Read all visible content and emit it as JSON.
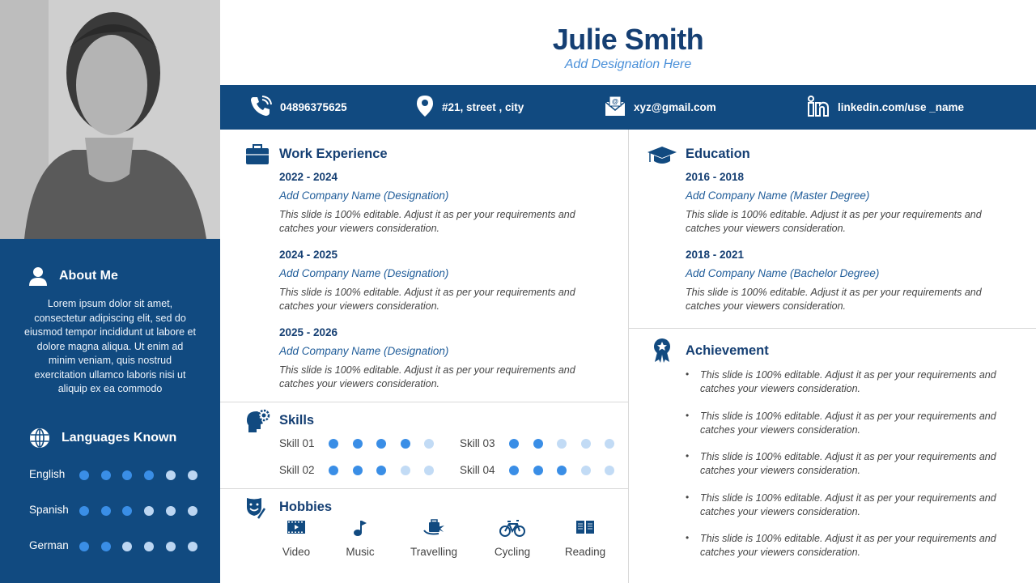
{
  "colors": {
    "primary": "#114a80",
    "heading": "#153f73",
    "accent": "#4a90d9",
    "dot_filled": "#3a8ee6",
    "dot_empty": "#c2dbf5",
    "dot_empty_dark": "#bcd6f2"
  },
  "header": {
    "name": "Julie Smith",
    "designation": "Add Designation Here"
  },
  "contacts": [
    {
      "icon": "phone-icon",
      "text": "04896375625"
    },
    {
      "icon": "location-pin-icon",
      "text": "#21, street , city"
    },
    {
      "icon": "email-icon",
      "text": "xyz@gmail.com"
    },
    {
      "icon": "linkedin-icon",
      "text": "linkedin.com/use _name"
    }
  ],
  "photo": {
    "icon": "profile-photo"
  },
  "about": {
    "title": "About Me",
    "icon": "user-icon",
    "text": "Lorem ipsum dolor sit amet, consectetur adipiscing elit, sed do eiusmod tempor incididunt ut labore et dolore magna aliqua. Ut enim ad minim veniam, quis nostrud exercitation ullamco laboris nisi ut aliquip ex ea commodo"
  },
  "languages": {
    "title": "Languages Known",
    "icon": "globe-icon",
    "max": 6,
    "items": [
      {
        "name": "English",
        "level": 4
      },
      {
        "name": "Spanish",
        "level": 3
      },
      {
        "name": "German",
        "level": 2
      }
    ]
  },
  "work": {
    "title": "Work Experience",
    "icon": "briefcase-icon",
    "items": [
      {
        "date": "2022 - 2024",
        "company": "Add Company Name (Designation)",
        "desc": "This slide is 100%  editable. Adjust it as per your requirements and catches your viewers consideration."
      },
      {
        "date": "2024 - 2025",
        "company": "Add Company Name (Designation)",
        "desc": "This slide is 100%  editable. Adjust it as per your requirements and catches your viewers consideration."
      },
      {
        "date": "2025 - 2026",
        "company": "Add Company Name (Designation)",
        "desc": "This slide is 100%  editable. Adjust it as per your requirements and catches your viewers consideration."
      }
    ]
  },
  "education": {
    "title": "Education",
    "icon": "graduation-cap-icon",
    "items": [
      {
        "date": " 2016 - 2018",
        "company": "Add Company Name (Master Degree)",
        "desc": "This slide is 100%  editable. Adjust it as per your requirements and catches your viewers consideration."
      },
      {
        "date": "2018 - 2021",
        "company": "Add Company Name (Bachelor Degree)",
        "desc": "This slide is 100%  editable. Adjust it as per your requirements and catches your viewers consideration."
      }
    ]
  },
  "achievement": {
    "title": "Achievement",
    "icon": "award-ribbon-icon",
    "items": [
      "This slide is 100%  editable. Adjust it as per your requirements and catches your viewers consideration.",
      "This slide is 100%  editable. Adjust it as per your requirements and catches your viewers consideration.",
      "This slide is 100%  editable. Adjust it as per your requirements and catches your viewers consideration.",
      "This slide is 100%  editable. Adjust it as per your requirements and catches your viewers consideration.",
      "This slide is 100%  editable. Adjust it as per your requirements and catches your viewers consideration."
    ]
  },
  "skills": {
    "title": "Skills",
    "icon": "head-gear-icon",
    "max": 5,
    "items": [
      {
        "name": "Skill 01",
        "level": 4
      },
      {
        "name": "Skill 02",
        "level": 3
      },
      {
        "name": "Skill 03",
        "level": 2
      },
      {
        "name": "Skill 04",
        "level": 3
      }
    ]
  },
  "hobbies": {
    "title": "Hobbies",
    "icon": "theater-mask-icon",
    "items": [
      {
        "name": "Video",
        "icon": "video-icon"
      },
      {
        "name": "Music",
        "icon": "music-note-icon"
      },
      {
        "name": "Travelling",
        "icon": "travel-luggage-icon"
      },
      {
        "name": "Cycling",
        "icon": "bicycle-icon"
      },
      {
        "name": "Reading",
        "icon": "book-icon"
      }
    ]
  }
}
